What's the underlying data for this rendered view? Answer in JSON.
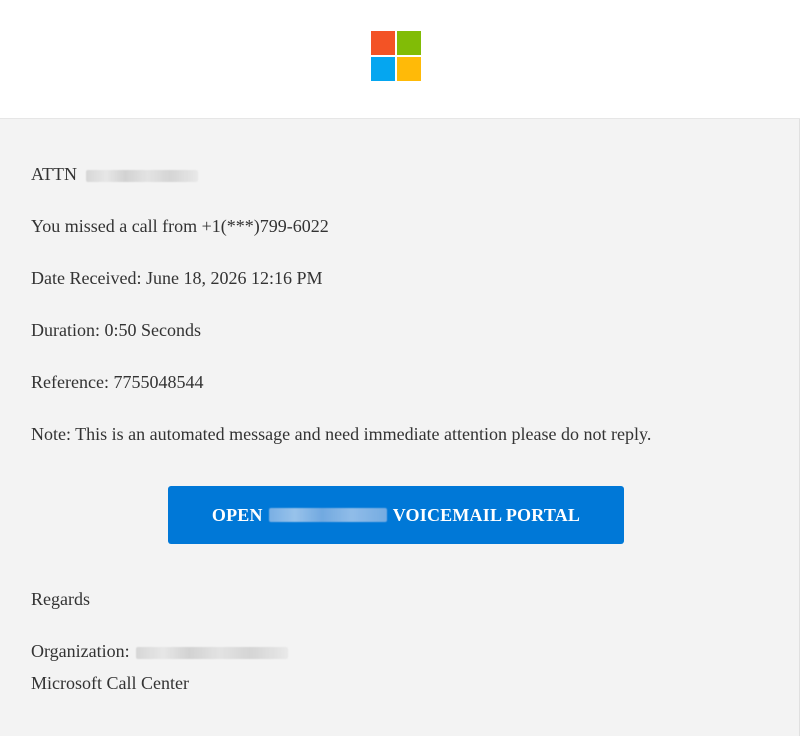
{
  "colors": {
    "logo_red": "#f35325",
    "logo_green": "#81bc06",
    "logo_blue": "#05a6f0",
    "logo_yellow": "#ffba08",
    "button_bg": "#0078d7",
    "content_bg": "#f3f3f3"
  },
  "header": {
    "logo_icon": "microsoft-logo-icon"
  },
  "email": {
    "attn_label": "ATTN",
    "missed_call": "You missed a call from +1(***)799-6022",
    "date_received": "Date Received: June 18, 2026 12:16 PM",
    "duration": "Duration: 0:50 Seconds",
    "reference": "Reference: 7755048544",
    "note": "Note: This is an automated message and need immediate attention please do not reply.",
    "button_prefix": "OPEN",
    "button_suffix": "VOICEMAIL PORTAL",
    "regards": "Regards",
    "organization_label": "Organization:",
    "signature": "Microsoft Call Center"
  }
}
